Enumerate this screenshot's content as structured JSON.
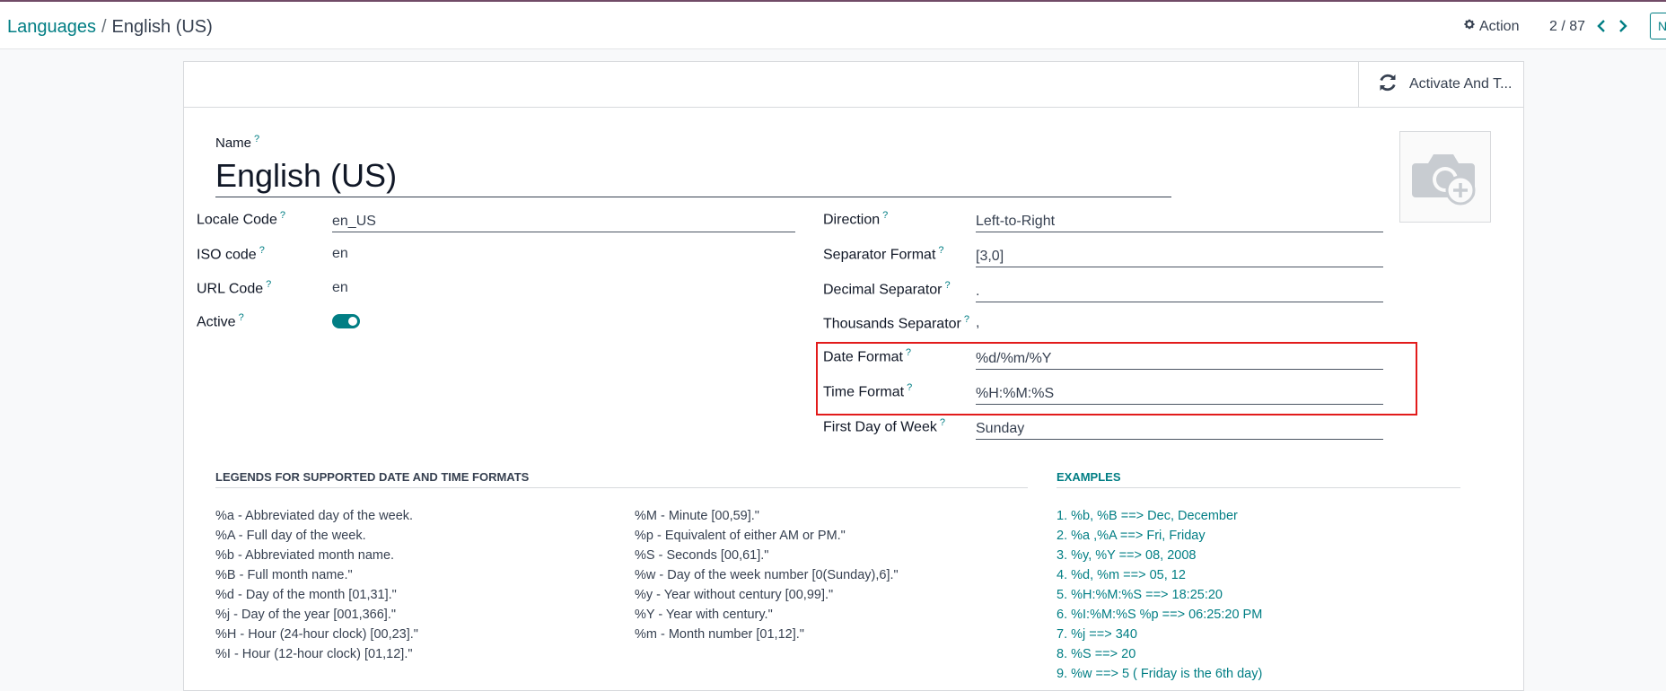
{
  "breadcrumb": {
    "parent": "Languages",
    "separator": "/",
    "current": "English (US)"
  },
  "toolbar": {
    "action_label": "Action",
    "pager": "2 / 87",
    "edge_button": "N"
  },
  "statusbar": {
    "activate_label": "Activate And T..."
  },
  "form": {
    "name_label": "Name",
    "name_value": "English (US)",
    "help_mark": "?",
    "left_fields": {
      "locale_code": {
        "label": "Locale Code",
        "value": "en_US"
      },
      "iso_code": {
        "label": "ISO code",
        "value": "en"
      },
      "url_code": {
        "label": "URL Code",
        "value": "en"
      },
      "active": {
        "label": "Active",
        "value": true
      }
    },
    "right_fields": {
      "direction": {
        "label": "Direction",
        "value": "Left-to-Right"
      },
      "separator_format": {
        "label": "Separator Format",
        "value": "[3,0]"
      },
      "decimal_separator": {
        "label": "Decimal Separator",
        "value": "."
      },
      "thousands_separator": {
        "label": "Thousands Separator",
        "value": ","
      },
      "date_format": {
        "label": "Date Format",
        "value": "%d/%m/%Y"
      },
      "time_format": {
        "label": "Time Format",
        "value": "%H:%M:%S"
      },
      "first_day_of_week": {
        "label": "First Day of Week",
        "value": "Sunday"
      }
    }
  },
  "legend": {
    "title": "LEGENDS FOR SUPPORTED DATE AND TIME FORMATS",
    "col1": [
      "%a - Abbreviated day of the week.",
      "%A - Full day of the week.",
      "%b - Abbreviated month name.",
      "%B - Full month name.\"",
      "%d - Day of the month [01,31].\"",
      "%j - Day of the year [001,366].\"",
      "%H - Hour (24-hour clock) [00,23].\"",
      "%I - Hour (12-hour clock) [01,12].\""
    ],
    "col2": [
      "%M - Minute [00,59].\"",
      "%p - Equivalent of either AM or PM.\"",
      "%S - Seconds [00,61].\"",
      "%w - Day of the week number [0(Sunday),6].\"",
      "%y - Year without century [00,99].\"",
      "%Y - Year with century.\"",
      "%m - Month number [01,12].\""
    ]
  },
  "examples": {
    "title": "EXAMPLES",
    "items": [
      "1. %b, %B ==> Dec, December",
      "2. %a ,%A ==> Fri, Friday",
      "3. %y, %Y ==> 08, 2008",
      "4. %d, %m ==> 05, 12",
      "5. %H:%M:%S ==> 18:25:20",
      "6. %I:%M:%S %p ==> 06:25:20 PM",
      "7. %j ==> 340",
      "8. %S ==> 20",
      "9. %w ==> 5 ( Friday is the 6th day)"
    ]
  },
  "colors": {
    "accent": "#017e84",
    "brand": "#714b67",
    "highlight": "#e21b1b"
  }
}
